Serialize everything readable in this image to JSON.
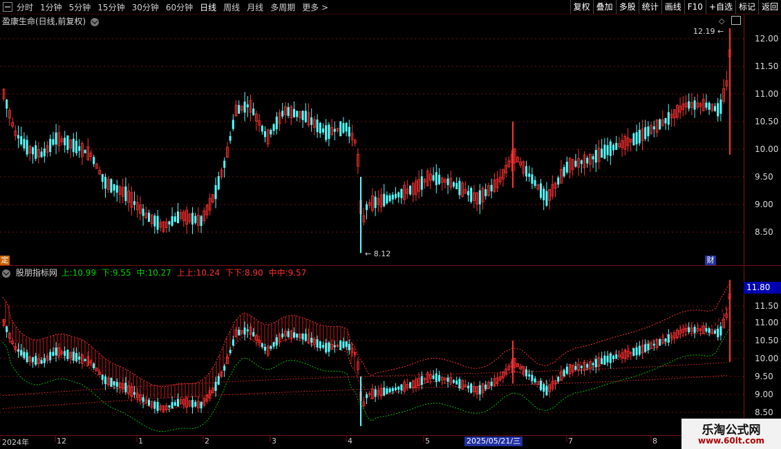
{
  "toolbar": {
    "tabs": [
      "分时",
      "1分钟",
      "5分钟",
      "15分钟",
      "30分钟",
      "60分钟",
      "日线",
      "周线",
      "月线",
      "多周期",
      "更多 >"
    ],
    "active_tab": "日线",
    "tools": [
      "复权",
      "叠加",
      "多股",
      "统计",
      "画线",
      "F10",
      "+自选",
      "标记",
      "返回"
    ]
  },
  "main_chart": {
    "title": "盈康生命(日线,前复权)",
    "high_label": "12.19",
    "low_label": "8.12",
    "yaxis": [
      "12.00",
      "11.50",
      "11.00",
      "10.50",
      "10.00",
      "9.50",
      "9.00",
      "8.50"
    ],
    "marker_left": "定",
    "marker_right": "财"
  },
  "indicator": {
    "name": "股朋指标网",
    "values": [
      {
        "label": "上:",
        "value": "10.99",
        "color": "#00d000"
      },
      {
        "label": "下:",
        "value": "9.55",
        "color": "#00d000"
      },
      {
        "label": "中:",
        "value": "10.27",
        "color": "#00d000"
      },
      {
        "label": "上上:",
        "value": "10.24",
        "color": "#ff3030"
      },
      {
        "label": "下下:",
        "value": "8.90",
        "color": "#ff3030"
      },
      {
        "label": "中中:",
        "value": "9.57",
        "color": "#ff3030"
      }
    ],
    "yaxis": [
      "11.50",
      "11.00",
      "10.50",
      "10.00",
      "9.50",
      "9.00",
      "8.50"
    ],
    "current_price": "11.80"
  },
  "xaxis": {
    "labels": [
      "2024年",
      "12",
      "1",
      "2",
      "3",
      "4",
      "5",
      "7",
      "8"
    ],
    "selected_date": "2025/05/21/三"
  },
  "watermark": {
    "line1": "乐淘公式网",
    "line2": "www.60lt.com"
  },
  "colors": {
    "up": "#ff3232",
    "down": "#54ffff",
    "grid": "#7a1010",
    "panel_bg": "#000000"
  }
}
